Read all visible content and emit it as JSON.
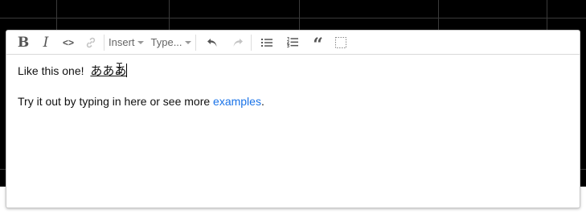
{
  "toolbar": {
    "bold_label": "B",
    "italic_label": "I",
    "code_label": "<>",
    "insert_label": "Insert",
    "type_label": "Type...",
    "blockquote_label": "“"
  },
  "content": {
    "line1_text": "Like this one!",
    "ime_text": "あああ",
    "line2_prefix": "Try it out by typing in here or see more ",
    "link_text": "examples",
    "line2_suffix": "."
  },
  "colors": {
    "background_dark": "#000000",
    "link": "#1a73e8",
    "toolbar_icon": "#555555",
    "toolbar_icon_disabled": "#bbbbbb"
  },
  "icons": [
    "bold-icon",
    "italic-icon",
    "code-icon",
    "link-icon",
    "undo-icon",
    "redo-icon",
    "bullet-list-icon",
    "ordered-list-icon",
    "blockquote-icon",
    "select-parent-icon",
    "text-cursor-icon"
  ]
}
